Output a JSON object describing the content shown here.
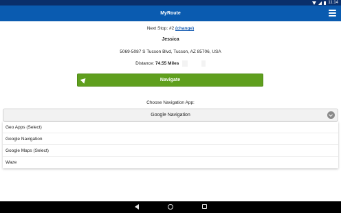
{
  "status_bar": {
    "time": "11:14"
  },
  "app_bar": {
    "title": "MyRoute"
  },
  "stop": {
    "label": "Next Stop: #2",
    "change_label": "(change)",
    "name": "Jessica",
    "address": "5069-5087 S Tucson Blvd, Tucson, AZ 85706, USA",
    "distance_label": "Distance:",
    "distance_value": "74.55 Miles"
  },
  "navigate_button": {
    "label": "Navigate"
  },
  "nav_app": {
    "label": "Choose Navigation App:",
    "selected": "Google Navigation",
    "options": [
      "Geo Apps (Select)",
      "Google Navigation",
      "Google Maps (Select)",
      "Waze"
    ]
  },
  "colors": {
    "app_bar": "#0a5bb0",
    "navigate": "#5f9f1e",
    "link": "#1a5fb4"
  }
}
